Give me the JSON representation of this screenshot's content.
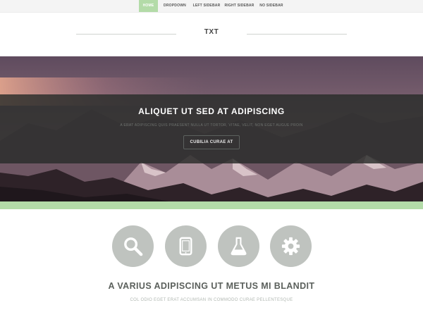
{
  "nav": {
    "items": [
      {
        "label": "HOME",
        "active": true
      },
      {
        "label": "DROPDOWN",
        "active": false
      },
      {
        "label": "LEFT SIDEBAR",
        "active": false
      },
      {
        "label": "RIGHT SIDEBAR",
        "active": false
      },
      {
        "label": "NO SIDEBAR",
        "active": false
      }
    ]
  },
  "header": {
    "logo": "TXT"
  },
  "hero": {
    "title": "ALIQUET UT SED AT ADIPISCING",
    "subtitle": "A ERAT ADIPISCING QUIS PRAESENT NULLA UT TORTOR, VITAE, VELIT, NON EGET AUGUE PROIN",
    "button": "CUBILIA CURAE AT"
  },
  "features": {
    "icons": [
      "search-icon",
      "tablet-icon",
      "flask-icon",
      "gear-icon"
    ],
    "title": "A VARIUS ADIPISCING UT METUS MI BLANDIT",
    "subtitle": "COL ODIO EGET ERAT ACCUMSAN IN COMMODO CURAE PELLENTESQUE"
  },
  "colors": {
    "accent": "#b3dba8",
    "banner": "#2c302e",
    "icon_circle": "#bfc3bf",
    "heading": "#5b605c",
    "subheading": "#b0b7b1"
  }
}
